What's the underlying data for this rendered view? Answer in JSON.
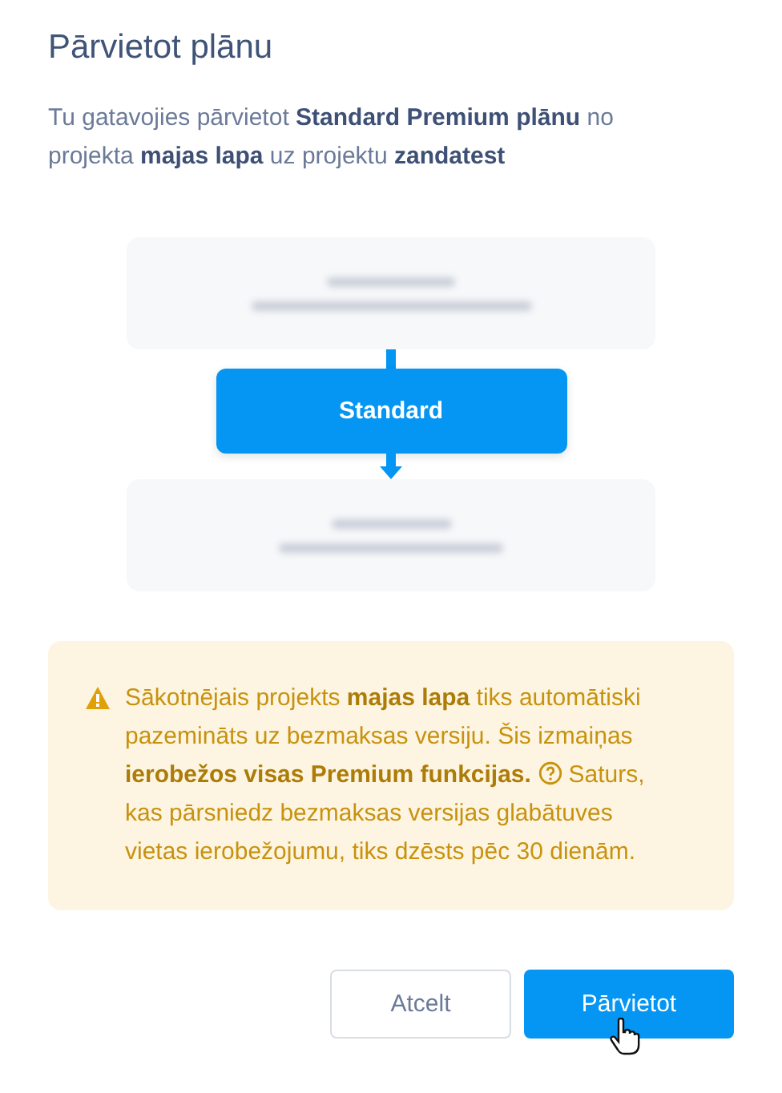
{
  "dialog": {
    "title": "Pārvietot plānu",
    "description": "Tu gatavojies pārvietot **Standard Premium plānu** no projekta **majas lapa** uz projektu **zandatest**"
  },
  "flow": {
    "plan": "Standard"
  },
  "warning": {
    "text_before_help": "Sākotnējais projekts **majas lapa** tiks automātiski pazemināts uz bezmaksas versiju. Šis izmaiņas **ierobežos visas Premium funkcijas.**",
    "text_after_help": "Saturs, kas pārsniedz bezmaksas versijas glabātuves vietas ierobežojumu, tiks dzēsts pēc 30 dienām."
  },
  "buttons": [
    {
      "label": "Atcelt",
      "kind": "secondary"
    },
    {
      "label": "Pārvietot",
      "kind": "primary"
    }
  ]
}
